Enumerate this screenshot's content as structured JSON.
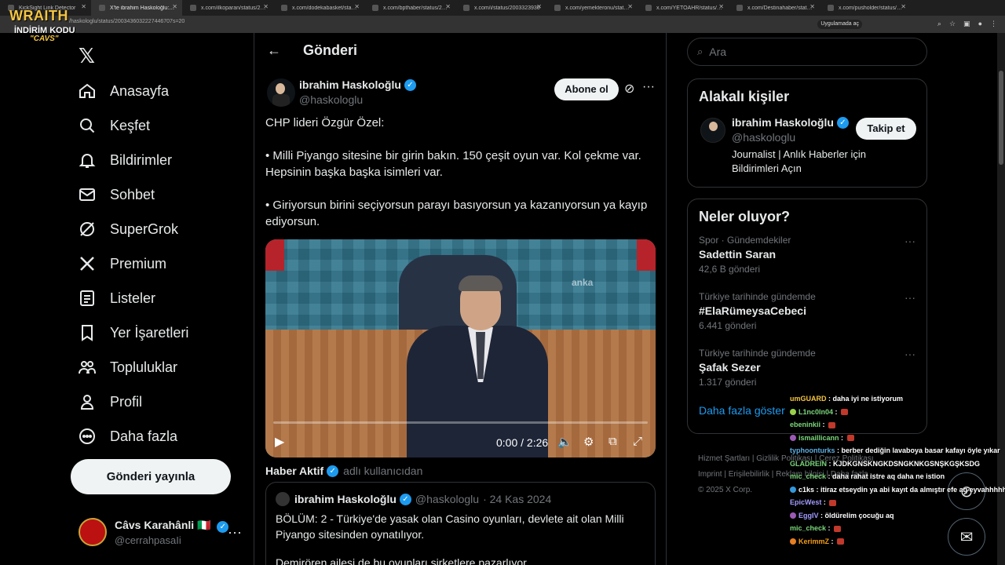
{
  "browser": {
    "tabs": [
      {
        "title": "KickSight Link Detector"
      },
      {
        "title": "X'te ibrahim Haskoloğlu: \"CHP"
      },
      {
        "title": "x.com/ilkoparan/status/2003"
      },
      {
        "title": "x.com/dodekabasket/status/2"
      },
      {
        "title": "x.com/bpthaber/status/20034"
      },
      {
        "title": "x.com/i/status/2003323930"
      },
      {
        "title": "x.com/yemekteronu/status/2"
      },
      {
        "title": "x.com/YETOAHR/status/2003"
      },
      {
        "title": "x.com/Destinahaber/status/2"
      },
      {
        "title": "x.com/pusholder/status/2003"
      }
    ],
    "url": "/haskologlu/status/2003436032227446707s=20",
    "app_button": "Uygulamada aç"
  },
  "overlay_logo": {
    "brand": "WRAITH",
    "line2": "İNDİRİM KODU",
    "line3": "\"CAVS\""
  },
  "nav": {
    "logo": "𝕏",
    "items": [
      {
        "label": "Anasayfa",
        "icon": "home-icon"
      },
      {
        "label": "Keşfet",
        "icon": "search-icon"
      },
      {
        "label": "Bildirimler",
        "icon": "bell-icon"
      },
      {
        "label": "Sohbet",
        "icon": "mail-icon"
      },
      {
        "label": "SuperGrok",
        "icon": "grok-icon"
      },
      {
        "label": "Premium",
        "icon": "x-icon"
      },
      {
        "label": "Listeler",
        "icon": "list-icon"
      },
      {
        "label": "Yer İşaretleri",
        "icon": "bookmark-icon"
      },
      {
        "label": "Topluluklar",
        "icon": "people-icon"
      },
      {
        "label": "Profil",
        "icon": "person-icon"
      },
      {
        "label": "Daha fazla",
        "icon": "more-circle-icon"
      }
    ],
    "post_button": "Gönderi yayınla",
    "account": {
      "name": "Câvs Karahânli 🇮🇹",
      "handle": "@cerrahpasaIi"
    }
  },
  "main": {
    "header_title": "Gönderi",
    "post": {
      "author": "ibrahim Haskoloğlu",
      "handle": "@haskologlu",
      "subscribe": "Abone ol",
      "paragraphs": [
        "CHP lideri Özgür Özel:",
        "• Milli Piyango sitesine bir girin bakın. 150 çeşit oyun var. Kol çekme var. Hepsinin başka başka isimleri var.",
        "• Giriyorsun birini seçiyorsun parayı basıyorsun ya kazanıyorsun ya kayıp ediyorsun."
      ],
      "video": {
        "watermark": "anka",
        "time": "0:00 / 2:26",
        "progress": 0
      }
    },
    "quoted_by": {
      "name": "Haber Aktif",
      "suffix": "adlı kullanıcıdan"
    },
    "quote": {
      "author": "ibrahim Haskoloğlu",
      "handle": "@haskologlu",
      "date": "· 24 Kas 2024",
      "paragraphs": [
        "BÖLÜM: 2 - Türkiye'de yasak olan Casino oyunları, devlete ait olan Milli Piyango sitesinden oynatılıyor.",
        "Demirören ailesi de bu oyunları şirketlere pazarlıyor."
      ]
    }
  },
  "sidebar": {
    "search_placeholder": "Ara",
    "related_title": "Alakalı kişiler",
    "related": {
      "name": "ibrahim Haskoloğlu",
      "handle": "@haskologlu",
      "bio": "Journalist | Anlık Haberler için Bildirimleri Açın",
      "follow": "Takip et"
    },
    "trends_title": "Neler oluyor?",
    "trends": [
      {
        "category": "Spor · Gündemdekiler",
        "name": "Sadettin Saran",
        "count": "42,6 B gönderi"
      },
      {
        "category": "Türkiye tarihinde gündemde",
        "name": "#ElaRümeysaCebeci",
        "count": "6.441 gönderi"
      },
      {
        "category": "Türkiye tarihinde gündemde",
        "name": "Şafak Sezer",
        "count": "1.317 gönderi"
      }
    ],
    "show_more": "Daha fazla göster",
    "footer": {
      "line1": "Hizmet Şartları  |  Gizlilik Politikası  |  Çerez Politikası",
      "line2": "Imprint  |  Erişilebilirlik  |  Reklam bilgisi  |  Daha fazla ···",
      "line3": "© 2025 X Corp."
    }
  },
  "chat": [
    {
      "user": "umGUARD",
      "color": "#f4c542",
      "text": "daha iyi ne istiyorum",
      "badge": ""
    },
    {
      "user": "L1nc0ln04",
      "color": "#7bd67b",
      "text": "",
      "badge": "#9ad14b",
      "emote": true
    },
    {
      "user": "ebeninkii",
      "color": "#7bd67b",
      "text": "",
      "badge": "",
      "emote": true
    },
    {
      "user": "ismaillicann",
      "color": "#7bd67b",
      "text": "",
      "badge": "#9b59b6",
      "emote": true
    },
    {
      "user": "typhoonturks",
      "color": "#5dade2",
      "text": "berber dediğin lavaboya basar kafayı öyle yıkar",
      "badge": ""
    },
    {
      "user": "GLADREIN",
      "color": "#7bd67b",
      "text": "KJDKGNSKNGKDSNGKNKGSNŞKGŞKSDG",
      "badge": ""
    },
    {
      "user": "mic_check",
      "color": "#7bd67b",
      "text": "daha rahat istre aq daha ne istion",
      "badge": ""
    },
    {
      "user": "c1ks",
      "color": "#fff",
      "text": "itiraz etseydin ya abi kayıt da almıştır efe aq eyvahhhhhh",
      "badge": "#3498db"
    },
    {
      "user": "EpicWest",
      "color": "#a29bfe",
      "text": "",
      "badge": "",
      "emote": true
    },
    {
      "user": "EggIV",
      "color": "#a29bfe",
      "text": "öldürelim çocuğu aq",
      "badge": "#9b59b6"
    },
    {
      "user": "mic_check",
      "color": "#7bd67b",
      "text": "",
      "badge": "",
      "emote": true
    },
    {
      "user": "KerimmZ",
      "color": "#f39c12",
      "text": "",
      "badge": "#e67e22",
      "emote": true
    }
  ]
}
